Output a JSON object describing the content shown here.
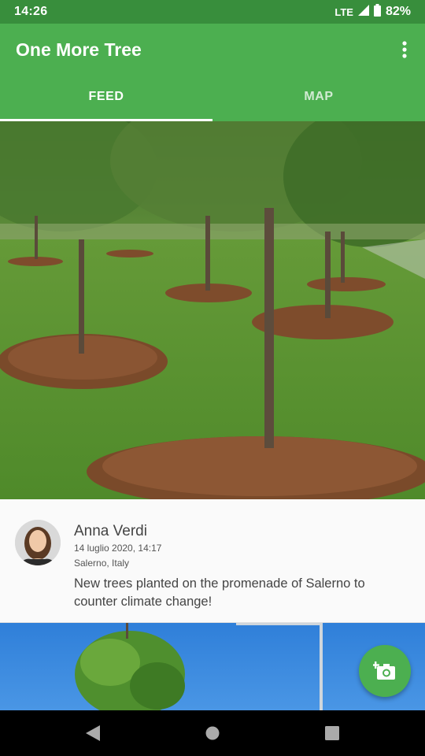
{
  "status_bar": {
    "time": "14:26",
    "network": "LTE",
    "battery": "82%",
    "icons": [
      "signal-icon",
      "battery-icon"
    ]
  },
  "app_bar": {
    "title": "One More Tree",
    "menu_icon": "more-vert-icon"
  },
  "tabs": [
    {
      "label": "FEED",
      "active": true
    },
    {
      "label": "MAP",
      "active": false
    }
  ],
  "feed": {
    "posts": [
      {
        "author": "Anna Verdi",
        "date": "14 luglio 2020, 14:17",
        "location": "Salerno, Italy",
        "text": "New trees planted on the promenade of Salerno to counter climate change!"
      }
    ]
  },
  "fab": {
    "icon": "add-photo-icon"
  },
  "nav_bar": {
    "icons": [
      "back-icon",
      "home-icon",
      "recents-icon"
    ]
  },
  "colors": {
    "primary": "#4caf50",
    "primary_dark": "#388e3c",
    "background": "#fafafa"
  }
}
